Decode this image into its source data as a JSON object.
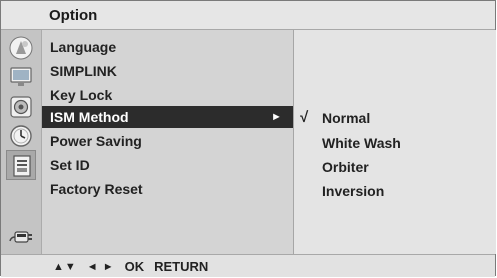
{
  "header": {
    "title": "Option"
  },
  "sidebar": {
    "icons": [
      "picture-icon",
      "screen-icon",
      "audio-icon",
      "clock-icon",
      "option-icon",
      "input-icon"
    ],
    "active_index": 4
  },
  "menu": {
    "items": [
      {
        "label": "Language"
      },
      {
        "label": "SIMPLINK"
      },
      {
        "label": "Key Lock"
      },
      {
        "label": "ISM Method",
        "arrow": "►"
      },
      {
        "label": "Power Saving"
      },
      {
        "label": "Set ID"
      },
      {
        "label": "Factory Reset"
      }
    ],
    "selected_index": 3
  },
  "submenu": {
    "check_mark": "√",
    "items": [
      {
        "label": "Normal"
      },
      {
        "label": "White Wash"
      },
      {
        "label": "Orbiter"
      },
      {
        "label": "Inversion"
      }
    ],
    "checked_index": 0
  },
  "footer": {
    "updown_glyph": "▲▼",
    "leftright_glyph": "◄ ►",
    "ok_label": "OK",
    "return_label": "RETURN"
  },
  "colors": {
    "selected_bg": "#2c2c2c",
    "menu_bg": "#d4d4d4",
    "submenu_bg": "#e4e4e4"
  }
}
